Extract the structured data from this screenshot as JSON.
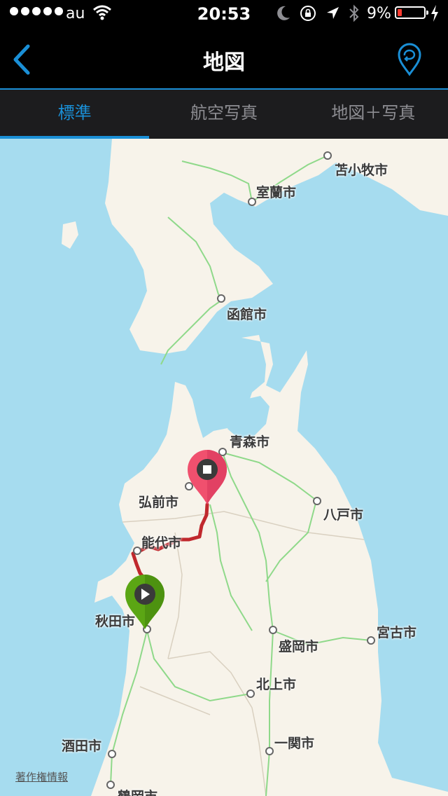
{
  "status_bar": {
    "carrier": "au",
    "time": "20:53",
    "battery_percent": "9%"
  },
  "nav": {
    "title": "地図"
  },
  "tabs": [
    {
      "label": "標準",
      "active": true
    },
    {
      "label": "航空写真",
      "active": false
    },
    {
      "label": "地図＋写真",
      "active": false
    }
  ],
  "map": {
    "cities": {
      "tomakomai": "苫小牧市",
      "muroran": "室蘭市",
      "hakodate": "函館市",
      "aomori": "青森市",
      "hirosaki": "弘前市",
      "hachinohe": "八戸市",
      "noshiro": "能代市",
      "akita": "秋田市",
      "morioka": "盛岡市",
      "miyako": "宮古市",
      "kitakami": "北上市",
      "ichinoseki": "一関市",
      "sakata": "酒田市",
      "tsuruoka": "鶴岡市"
    },
    "attribution": "著作権情報",
    "colors": {
      "water": "#a6dcef",
      "land": "#f7f3ea",
      "route": "#c0282d",
      "start_pin": "#5ba614",
      "end_pin": "#f0506e",
      "rail": "#8fd98a"
    }
  }
}
